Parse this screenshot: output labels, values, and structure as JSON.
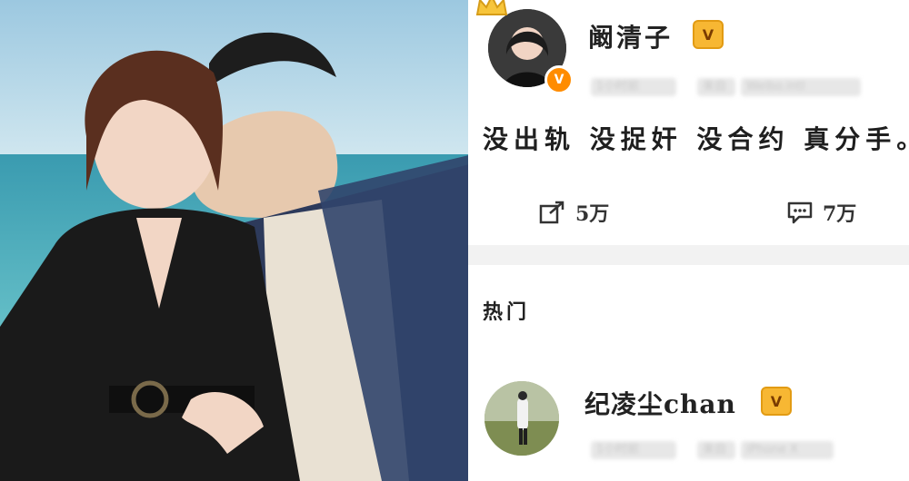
{
  "post": {
    "author": "阚清子",
    "vip_badge": "V",
    "verified_badge": "V",
    "meta_blurred": [
      "1小时前",
      "来自",
      "Weibo.intl"
    ],
    "text": "没出轨 没捉奸 没合约 真分手。",
    "actions": {
      "repost_count": "5万",
      "comment_count": "7万"
    }
  },
  "section": {
    "title": "热门"
  },
  "comment": {
    "author": "纪凌尘chan",
    "vip_badge": "V",
    "meta_blurred": [
      "1小时前",
      "来自",
      "iPhone X"
    ]
  },
  "colors": {
    "sea": "#4fb3bf",
    "sky": "#a9d3e6",
    "sand": "#e9e3d6",
    "verified": "#ff8c00",
    "vip": "#f7b733"
  },
  "icons": [
    "crown-icon",
    "verified-icon",
    "vip-icon",
    "repost-icon",
    "comment-icon"
  ]
}
